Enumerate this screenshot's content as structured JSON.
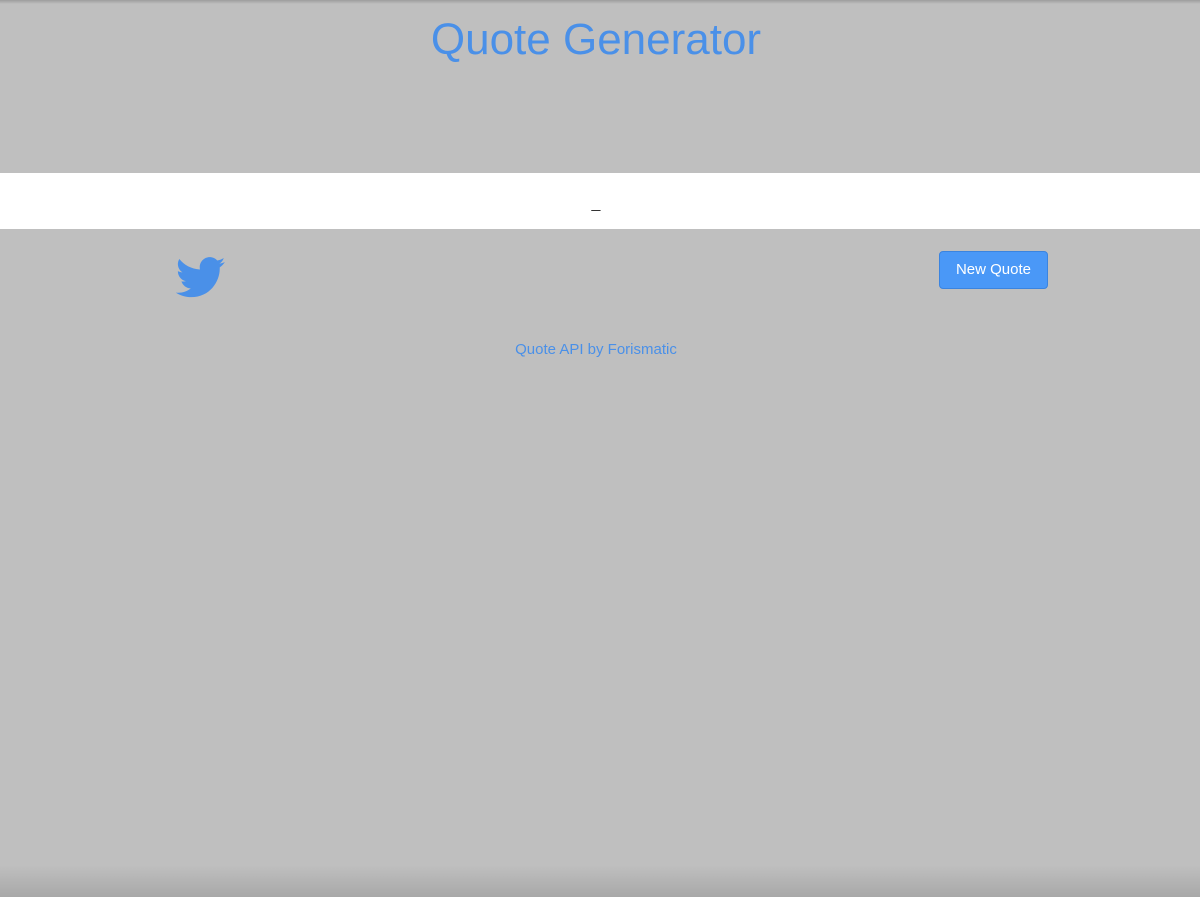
{
  "header": {
    "title": "Quote Generator"
  },
  "quote": {
    "text": "",
    "author": "_"
  },
  "actions": {
    "tweet_icon": "twitter-bird-icon",
    "new_quote_label": "New Quote"
  },
  "footer": {
    "credit_link": "Quote API by Forismatic"
  },
  "colors": {
    "background": "#bfbfbf",
    "accent": "#4a90e8",
    "button": "#4a98f7",
    "quote_band": "#ffffff"
  }
}
